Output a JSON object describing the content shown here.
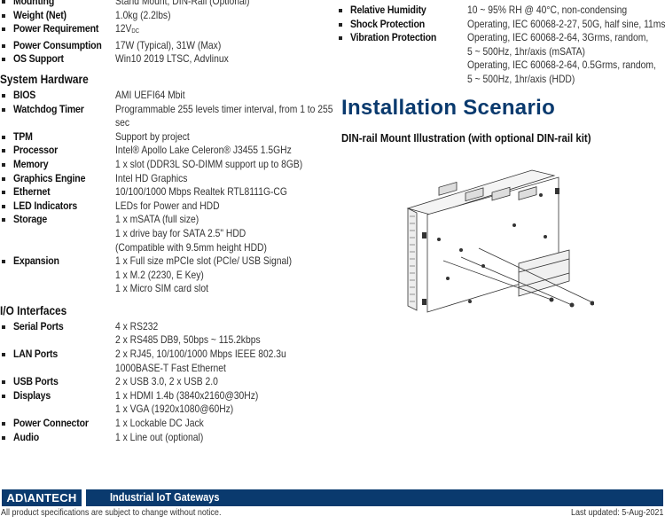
{
  "left_column": {
    "general_tail": [
      {
        "label": "Mounting",
        "values": [
          "Stand Mount, DIN-Rail (Optional)"
        ]
      },
      {
        "label": "Weight (Net)",
        "values": [
          "1.0kg (2.2lbs)"
        ]
      },
      {
        "label": "Power Requirement",
        "values": [
          "12V"
        ],
        "value_sub": "DC"
      },
      {
        "label": "Power Consumption",
        "values": [
          "17W (Typical), 31W (Max)"
        ]
      },
      {
        "label": "OS Support",
        "values": [
          "Win10 2019 LTSC, Advlinux"
        ]
      }
    ],
    "system_hardware": {
      "title": "System Hardware",
      "items": [
        {
          "label": "BIOS",
          "values": [
            "AMI UEFI64 Mbit"
          ]
        },
        {
          "label": "Watchdog Timer",
          "values": [
            "Programmable 255 levels timer interval, from 1 to 255",
            "sec"
          ]
        },
        {
          "label": "TPM",
          "values": [
            "Support by project"
          ]
        },
        {
          "label": "Processor",
          "values": [
            "Intel® Apollo Lake Celeron® J3455 1.5GHz"
          ]
        },
        {
          "label": "Memory",
          "values": [
            "1 x slot (DDR3L SO-DIMM support up to 8GB)"
          ]
        },
        {
          "label": "Graphics Engine",
          "values": [
            "Intel HD Graphics"
          ]
        },
        {
          "label": "Ethernet",
          "values": [
            "10/100/1000 Mbps Realtek RTL8111G-CG"
          ]
        },
        {
          "label": "LED Indicators",
          "values": [
            "LEDs for Power and HDD"
          ]
        },
        {
          "label": "Storage",
          "values": [
            "1 x mSATA (full size)",
            "1 x drive bay for SATA 2.5\" HDD",
            "(Compatible with 9.5mm height HDD)"
          ]
        },
        {
          "label": "Expansion",
          "values": [
            "1 x Full size mPCIe slot (PCIe/ USB Signal)",
            "1 x M.2 (2230, E Key)",
            "1 x Micro SIM card slot"
          ]
        }
      ]
    },
    "io_interfaces": {
      "title": "I/O Interfaces",
      "items": [
        {
          "label": "Serial Ports",
          "values": [
            "4 x RS232",
            "2 x RS485 DB9, 50bps ~ 115.2kbps"
          ]
        },
        {
          "label": "LAN Ports",
          "values": [
            "2 x RJ45, 10/100/1000 Mbps IEEE 802.3u",
            "1000BASE-T Fast Ethernet"
          ]
        },
        {
          "label": "USB Ports",
          "values": [
            "2 x USB 3.0, 2 x USB 2.0"
          ]
        },
        {
          "label": "Displays",
          "values": [
            "1 x HDMI 1.4b (3840x2160@30Hz)",
            "1 x VGA  (1920x1080@60Hz)"
          ]
        },
        {
          "label": "Power Connector",
          "values": [
            "1 x Lockable DC Jack"
          ]
        },
        {
          "label": "Audio",
          "values": [
            "1 x Line out (optional)"
          ]
        }
      ]
    }
  },
  "right_column": {
    "environment_tail": [
      {
        "label": "Relative Humidity",
        "values": [
          "10 ~ 95% RH @ 40°C, non-condensing"
        ]
      },
      {
        "label": "Shock Protection",
        "values": [
          "Operating, IEC 60068-2-27, 50G, half sine, 11ms"
        ]
      },
      {
        "label": "Vibration Protection",
        "values": [
          "Operating, IEC 60068-2-64, 3Grms, random,",
          "5 ~ 500Hz, 1hr/axis (mSATA)",
          "Operating, IEC 60068-2-64, 0.5Grms, random,",
          "5 ~ 500Hz, 1hr/axis (HDD)"
        ]
      }
    ],
    "installation": {
      "title": "Installation Scenario",
      "subtitle": "DIN-rail Mount Illustration (with optional DIN-rail kit)"
    }
  },
  "footer": {
    "logo": "AD\\ANTECH",
    "category": "Industrial IoT Gateways",
    "disclaimer": "All product specifications are subject to change without notice.",
    "last_updated": "Last updated: 5-Aug-2021"
  },
  "colors": {
    "brand_blue": "#0a3a6e"
  }
}
